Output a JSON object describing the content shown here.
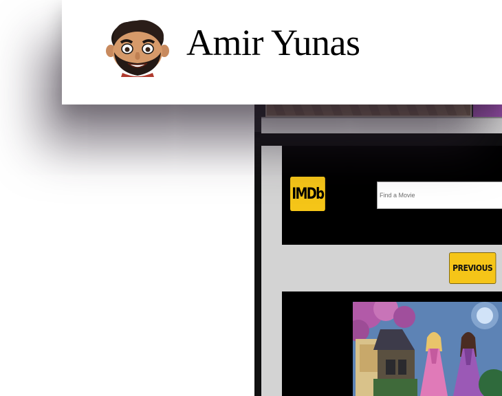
{
  "profile": {
    "name": "Amir Yunas",
    "avatar_icon": "bitmoji-avatar-icon"
  },
  "embedded_app": {
    "logo_text": "IMDb",
    "search": {
      "placeholder": "Find a Movie",
      "value": ""
    },
    "previous_label": "PREVIOUS",
    "colors": {
      "brand_yellow": "#f5c518",
      "header_bg": "#000000",
      "page_bg": "#d3d3d3",
      "accent_purple": "#8e4aa0"
    }
  }
}
